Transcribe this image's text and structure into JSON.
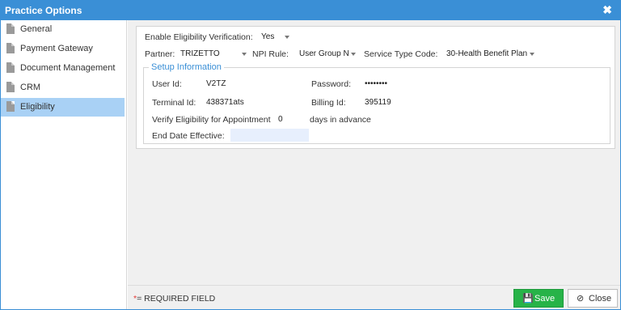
{
  "window": {
    "title": "Practice Options",
    "close_glyph": "✖"
  },
  "sidebar": {
    "items": [
      {
        "label": "General",
        "icon": "document-icon"
      },
      {
        "label": "Payment Gateway",
        "icon": "document-icon"
      },
      {
        "label": "Document Management",
        "icon": "document-icon"
      },
      {
        "label": "CRM",
        "icon": "document-icon"
      },
      {
        "label": "Eligibility",
        "icon": "document-icon",
        "active": true
      }
    ]
  },
  "form": {
    "enable_label": "Enable Eligibility Verification:",
    "enable_value": "Yes",
    "partner_label": "Partner:",
    "partner_value": "TRIZETTO",
    "npi_label": "NPI Rule:",
    "npi_value": "User Group N",
    "service_label": "Service Type Code:",
    "service_value": "30-Health Benefit Plan"
  },
  "setup": {
    "legend": "Setup Information",
    "user_id_label": "User Id:",
    "user_id_value": "V2TZ",
    "password_label": "Password:",
    "password_value": "••••••••",
    "terminal_label": "Terminal Id:",
    "terminal_value": "438371ats",
    "billing_label": "Billing Id:",
    "billing_value": "395119",
    "verify_label": "Verify Eligibility for Appointment",
    "verify_value": "0",
    "verify_suffix": "days in advance",
    "end_date_label": "End Date Effective:",
    "end_date_value": ""
  },
  "footer": {
    "required_star": "*",
    "required_text": "= REQUIRED FIELD",
    "save_label": "Save",
    "close_label": "Close"
  },
  "colors": {
    "accent": "#3a8fd6",
    "active_nav": "#a9d1f5",
    "save": "#27b348"
  }
}
